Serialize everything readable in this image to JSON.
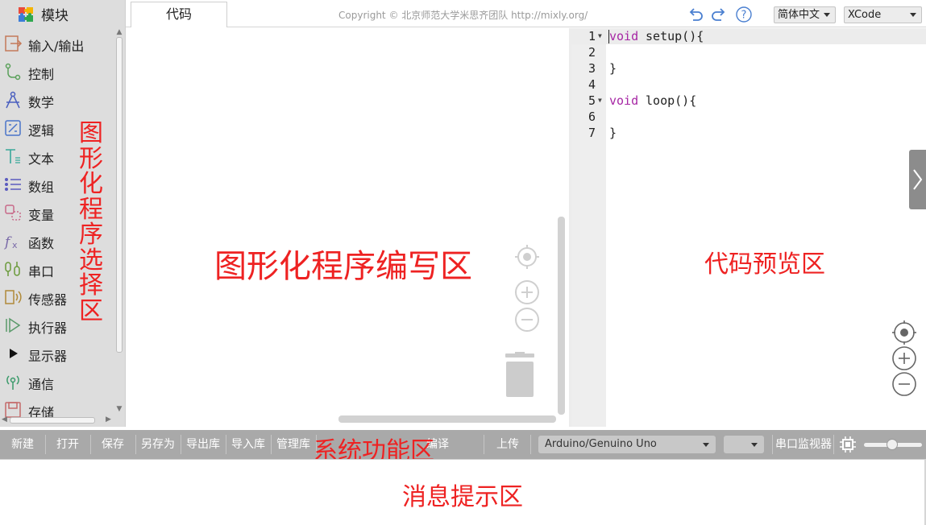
{
  "sidebar": {
    "title": "模块",
    "categories": [
      {
        "label": "输入/输出",
        "icon": "input-output-icon"
      },
      {
        "label": "控制",
        "icon": "control-icon"
      },
      {
        "label": "数学",
        "icon": "math-icon"
      },
      {
        "label": "逻辑",
        "icon": "logic-icon"
      },
      {
        "label": "文本",
        "icon": "text-icon"
      },
      {
        "label": "数组",
        "icon": "array-icon"
      },
      {
        "label": "变量",
        "icon": "variable-icon"
      },
      {
        "label": "函数",
        "icon": "function-icon"
      },
      {
        "label": "串口",
        "icon": "serial-icon"
      },
      {
        "label": "传感器",
        "icon": "sensor-icon"
      },
      {
        "label": "执行器",
        "icon": "actuator-icon"
      },
      {
        "label": "显示器",
        "icon": "display-icon"
      },
      {
        "label": "通信",
        "icon": "communication-icon"
      },
      {
        "label": "存储",
        "icon": "storage-icon"
      }
    ]
  },
  "header": {
    "tab_label": "代码",
    "copyright": "Copyright © 北京师范大学米思齐团队 http://mixly.org/",
    "language": "简体中文",
    "theme": "XCode"
  },
  "code": {
    "lines": [
      {
        "num": "1",
        "fold": true,
        "keyword": "void",
        "text": " setup(){"
      },
      {
        "num": "2",
        "fold": false,
        "keyword": "",
        "text": ""
      },
      {
        "num": "3",
        "fold": false,
        "keyword": "",
        "text": "}"
      },
      {
        "num": "4",
        "fold": false,
        "keyword": "",
        "text": ""
      },
      {
        "num": "5",
        "fold": true,
        "keyword": "void",
        "text": " loop(){"
      },
      {
        "num": "6",
        "fold": false,
        "keyword": "",
        "text": ""
      },
      {
        "num": "7",
        "fold": false,
        "keyword": "",
        "text": "}"
      }
    ]
  },
  "toolbar": {
    "new": "新建",
    "open": "打开",
    "save": "保存",
    "save_as": "另存为",
    "export_lib": "导出库",
    "import_lib": "导入库",
    "manage_lib": "管理库",
    "compile": "编译",
    "upload": "上传",
    "board": "Arduino/Genuino Uno",
    "port": "",
    "serial_monitor": "串口监视器"
  },
  "annotations": {
    "sidebar": "图形化程序选择区",
    "workspace": "图形化程序编写区",
    "code": "代码预览区",
    "toolbar": "系统功能区",
    "messages": "消息提示区"
  },
  "colors": {
    "annotation": "#ee2222",
    "keyword": "#a626a4",
    "toolbar_bg": "#a9a9a9",
    "sidebar_bg": "#dddddd"
  }
}
